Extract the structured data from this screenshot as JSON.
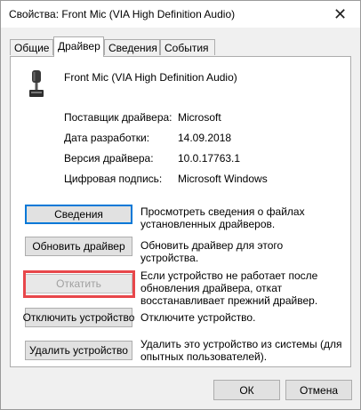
{
  "window": {
    "title": "Свойства: Front Mic (VIA High Definition Audio)"
  },
  "tabs": [
    {
      "label": "Общие",
      "active": false
    },
    {
      "label": "Драйвер",
      "active": true
    },
    {
      "label": "Сведения",
      "active": false
    },
    {
      "label": "События",
      "active": false
    }
  ],
  "device": {
    "name": "Front Mic (VIA High Definition Audio)",
    "icon": "microphone-icon"
  },
  "properties": [
    {
      "label": "Поставщик драйвера:",
      "value": "Microsoft"
    },
    {
      "label": "Дата разработки:",
      "value": "14.09.2018"
    },
    {
      "label": "Версия драйвера:",
      "value": "10.0.17763.1"
    },
    {
      "label": "Цифровая подпись:",
      "value": "Microsoft Windows"
    }
  ],
  "actions": [
    {
      "button": "Сведения",
      "description": "Просмотреть сведения о файлах установленных драйверов.",
      "enabled": true
    },
    {
      "button": "Обновить драйвер",
      "description": "Обновить драйвер для этого устройства.",
      "enabled": true
    },
    {
      "button": "Откатить",
      "description": "Если устройство не работает после обновления драйвера, откат восстанавливает прежний драйвер.",
      "enabled": false
    },
    {
      "button": "Отключить устройство",
      "description": "Отключите устройство.",
      "enabled": true
    },
    {
      "button": "Удалить устройство",
      "description": "Удалить это устройство из системы (для опытных пользователей).",
      "enabled": true
    }
  ],
  "footer": {
    "ok_label": "ОК",
    "cancel_label": "Отмена"
  },
  "colors": {
    "highlight": "#e8474b",
    "focus": "#0078d7"
  }
}
